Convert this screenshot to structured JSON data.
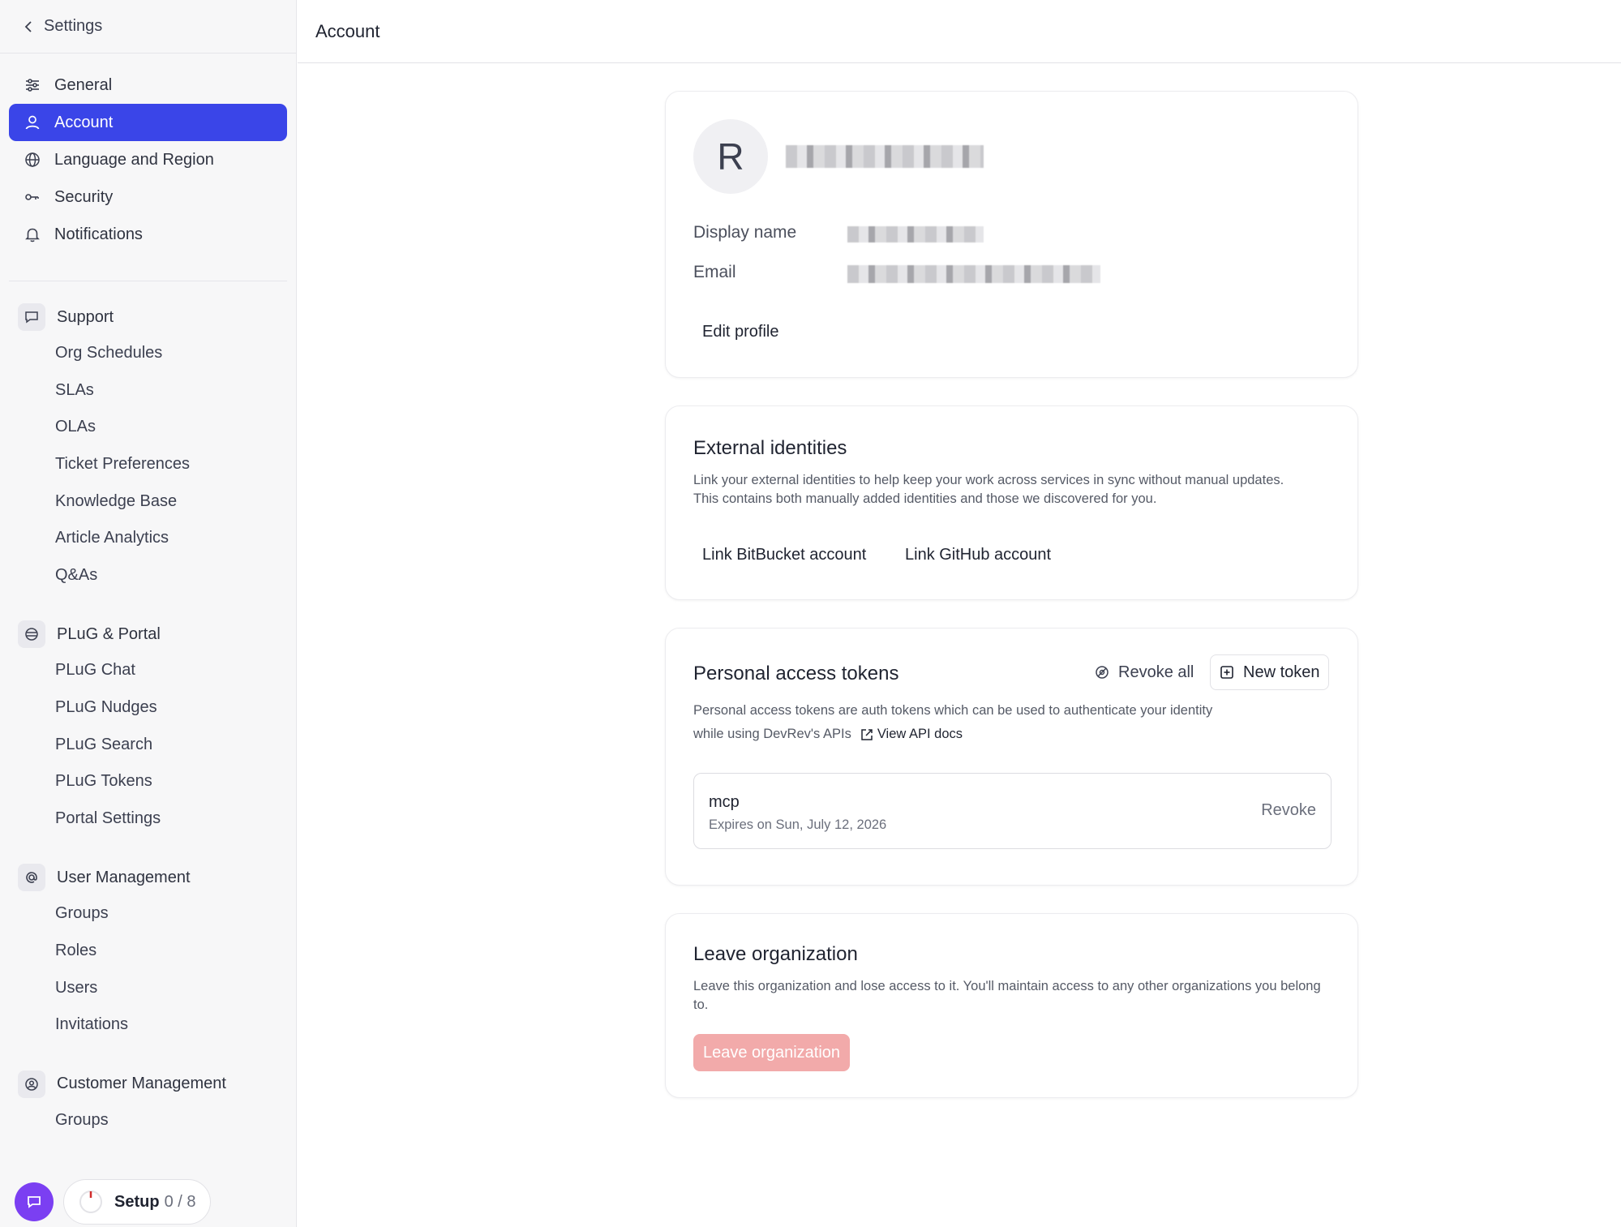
{
  "sidebar": {
    "back_label": "Settings",
    "items": [
      {
        "label": "General"
      },
      {
        "label": "Account"
      },
      {
        "label": "Language and Region"
      },
      {
        "label": "Security"
      },
      {
        "label": "Notifications"
      }
    ],
    "groups": [
      {
        "title": "Support",
        "items": [
          "Org Schedules",
          "SLAs",
          "OLAs",
          "Ticket Preferences",
          "Knowledge Base",
          "Article Analytics",
          "Q&As"
        ]
      },
      {
        "title": "PLuG & Portal",
        "items": [
          "PLuG Chat",
          "PLuG Nudges",
          "PLuG Search",
          "PLuG Tokens",
          "Portal Settings"
        ]
      },
      {
        "title": "User Management",
        "items": [
          "Groups",
          "Roles",
          "Users",
          "Invitations"
        ]
      },
      {
        "title": "Customer Management",
        "items": [
          "Groups"
        ]
      }
    ],
    "setup": {
      "label": "Setup",
      "count": "0 / 8"
    }
  },
  "header": {
    "title": "Account"
  },
  "profile": {
    "avatar_initial": "R",
    "display_name_label": "Display name",
    "email_label": "Email",
    "edit_label": "Edit profile"
  },
  "external": {
    "title": "External identities",
    "description": "Link your external identities to help keep your work across services in sync without manual updates. This contains both manually added identities and those we discovered for you.",
    "bitbucket_label": "Link BitBucket account",
    "github_label": "Link GitHub account"
  },
  "tokens": {
    "title": "Personal access tokens",
    "revoke_all_label": "Revoke all",
    "new_token_label": "New token",
    "description": "Personal access tokens are auth tokens which can be used to authenticate your identity",
    "description_2": "while using DevRev's APIs",
    "api_docs_label": "View API docs",
    "list": [
      {
        "name": "mcp",
        "expires": "Expires on  Sun, July 12, 2026",
        "action": "Revoke"
      }
    ]
  },
  "leave": {
    "title": "Leave organization",
    "description": "Leave this organization and lose access to it. You'll maintain access to any other organizations you belong to.",
    "button_label": "Leave organization"
  },
  "colors": {
    "accent": "#3a45e8",
    "chat": "#7b3ff2",
    "danger_muted": "#f2aaaa"
  }
}
